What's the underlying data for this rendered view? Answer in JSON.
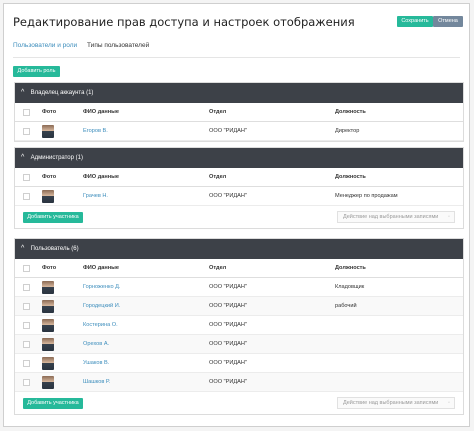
{
  "header": {
    "title": "Редактирование прав доступа и настроек отображения",
    "save_label": "Сохранить",
    "cancel_label": "Отмена"
  },
  "tabs": [
    {
      "label": "Пользователи и роли"
    },
    {
      "label": "Типы пользователей"
    }
  ],
  "add_role_label": "Добавить роль",
  "columns": {
    "photo": "Фото",
    "name": "ФИО данные",
    "org": "Отдел",
    "role": "Должность"
  },
  "add_member_label": "Добавить участника",
  "bulk_placeholder": "Действие над выбранными записями",
  "groups": [
    {
      "title": "Владелец аккаунта (1)",
      "rows": [
        {
          "name": "Егоров В.",
          "org": "ООО \"РИДАН\"",
          "role": "Директор"
        }
      ]
    },
    {
      "title": "Администратор (1)",
      "rows": [
        {
          "name": "Грачев Н.",
          "org": "ООО \"РИДАН\"",
          "role": "Менеджер по продажам"
        }
      ]
    },
    {
      "title": "Пользователь (6)",
      "rows": [
        {
          "name": "Горноженко Д.",
          "org": "ООО \"РИДАН\"",
          "role": "Кладовщик"
        },
        {
          "name": "Городецкий И.",
          "org": "ООО \"РИДАН\"",
          "role": "рабочий"
        },
        {
          "name": "Костерина О.",
          "org": "ООО \"РИДАН\"",
          "role": ""
        },
        {
          "name": "Орехов А.",
          "org": "ООО \"РИДАН\"",
          "role": ""
        },
        {
          "name": "Ушаков В.",
          "org": "ООО \"РИДАН\"",
          "role": ""
        },
        {
          "name": "Шашков Р.",
          "org": "ООО \"РИДАН\"",
          "role": ""
        }
      ]
    }
  ]
}
